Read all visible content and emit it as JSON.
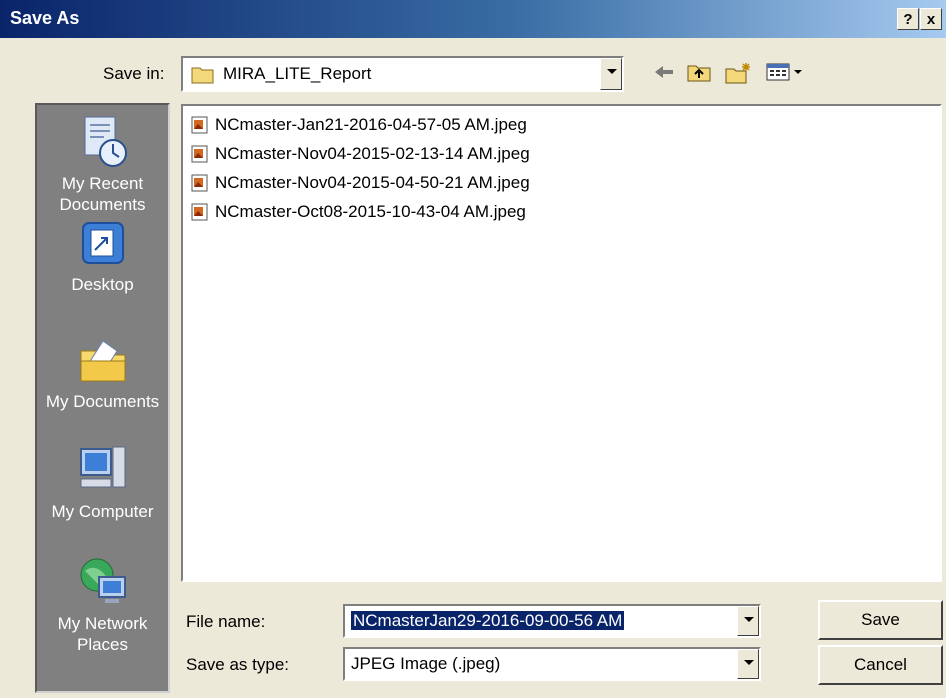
{
  "window": {
    "title": "Save As",
    "help_glyph": "?",
    "close_glyph": "x"
  },
  "toolbar": {
    "save_in_label": "Save in:",
    "save_in_value": "MIRA_LITE_Report",
    "icons": [
      "back-arrow-icon",
      "up-folder-icon",
      "new-folder-icon",
      "view-menu-icon"
    ]
  },
  "places": [
    {
      "id": "recent",
      "line1": "My Recent",
      "line2": "Documents",
      "icon": "recent-documents-icon"
    },
    {
      "id": "desktop",
      "line1": "Desktop",
      "line2": "",
      "icon": "desktop-icon"
    },
    {
      "id": "mydocs",
      "line1": "My Documents",
      "line2": "",
      "icon": "my-documents-icon"
    },
    {
      "id": "mycomputer",
      "line1": "My Computer",
      "line2": "",
      "icon": "my-computer-icon"
    },
    {
      "id": "network",
      "line1": "My Network",
      "line2": "Places",
      "icon": "network-places-icon"
    }
  ],
  "files": [
    "NCmaster-Jan21-2016-04-57-05 AM.jpeg",
    "NCmaster-Nov04-2015-02-13-14 AM.jpeg",
    "NCmaster-Nov04-2015-04-50-21 AM.jpeg",
    "NCmaster-Oct08-2015-10-43-04 AM.jpeg"
  ],
  "form": {
    "file_name_label": "File name:",
    "file_name_value": "NCmasterJan29-2016-09-00-56 AM",
    "save_type_label": "Save as type:",
    "save_type_value": "JPEG Image (.jpeg)"
  },
  "buttons": {
    "save": "Save",
    "cancel": "Cancel"
  },
  "colors": {
    "title_start": "#0a246a",
    "title_end": "#a6caf0",
    "dialog_bg": "#ece9d8",
    "places_bg": "#808080",
    "selection": "#0a246a"
  }
}
